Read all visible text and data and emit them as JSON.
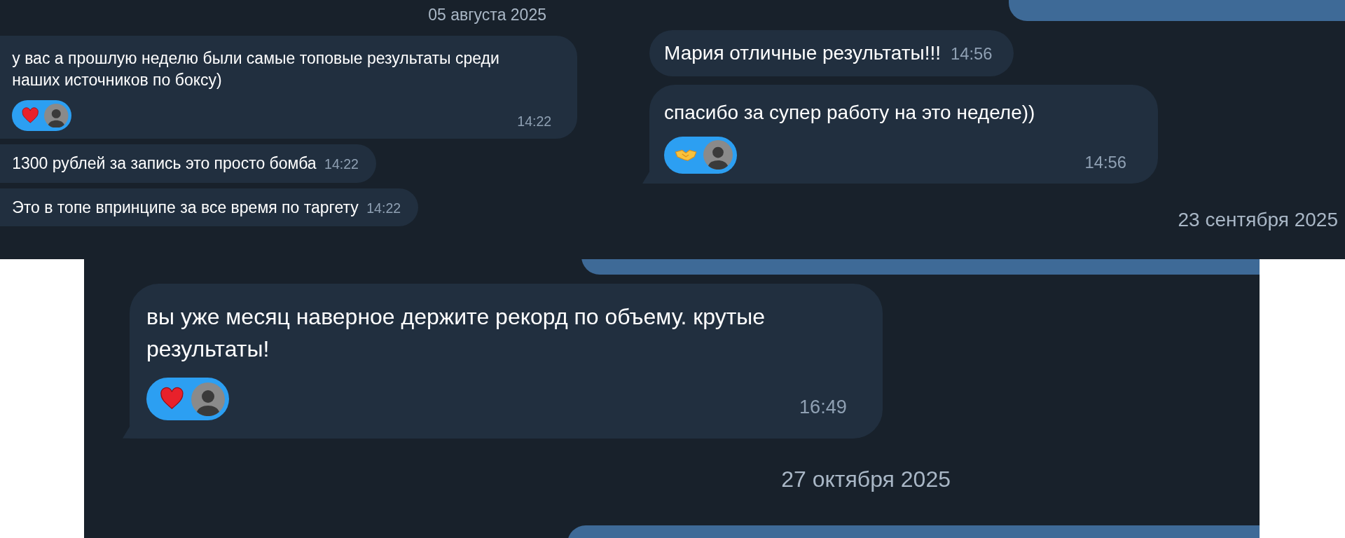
{
  "panels": [
    {
      "items": [
        {
          "kind": "date",
          "text": "05 августа 2025"
        },
        {
          "kind": "message",
          "text": "у вас а прошлую неделю были самые топовые результаты среди наших источников по боксу)",
          "time": "14:22",
          "reactions": [
            {
              "kind": "heart"
            }
          ]
        },
        {
          "kind": "message",
          "text": "1300 рублей за запись это просто бомба",
          "time": "14:22"
        },
        {
          "kind": "message",
          "text": "Это в топе впринципе за все время по таргету",
          "time": "14:22"
        }
      ]
    },
    {
      "items": [
        {
          "kind": "message",
          "text": "Мария отличные результаты!!!",
          "time": "14:56",
          "tail": false
        },
        {
          "kind": "message",
          "text": "спасибо за супер работу на это неделе))",
          "time": "14:56",
          "tail": true,
          "reactions": [
            {
              "kind": "handshake"
            }
          ]
        },
        {
          "kind": "date",
          "text": "23 сентября 2025"
        }
      ]
    },
    {
      "items": [
        {
          "kind": "message",
          "text": "вы уже месяц наверное держите рекорд по объему. крутые результаты!",
          "time": "16:49",
          "tail": true,
          "reactions": [
            {
              "kind": "heart"
            }
          ]
        },
        {
          "kind": "date",
          "text": "27 октября 2025"
        }
      ]
    }
  ]
}
